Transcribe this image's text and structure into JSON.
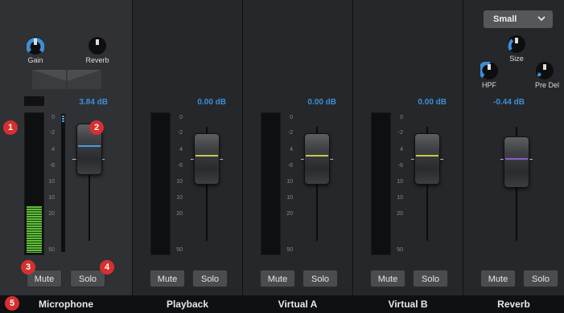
{
  "channels": [
    {
      "name": "Microphone",
      "db": "3.84 dB",
      "mute": "Mute",
      "solo": "Solo"
    },
    {
      "name": "Playback",
      "db": "0.00 dB",
      "mute": "Mute",
      "solo": "Solo"
    },
    {
      "name": "Virtual A",
      "db": "0.00 dB",
      "mute": "Mute",
      "solo": "Solo"
    },
    {
      "name": "Virtual B",
      "db": "0.00 dB",
      "mute": "Mute",
      "solo": "Solo"
    },
    {
      "name": "Reverb",
      "db": "-0.44 dB",
      "mute": "Mute",
      "solo": "Solo"
    }
  ],
  "mic_knobs": {
    "gain": "Gain",
    "reverb": "Reverb"
  },
  "reverb_knobs": {
    "size": "Size",
    "hpf": "HPF",
    "pre_delay": "Pre Del"
  },
  "reverb_size_select": {
    "value": "Small",
    "chevron_icon": "chevron-down-icon"
  },
  "scale_ticks": [
    "0",
    "-2",
    "4",
    "-6",
    "10",
    "10",
    "20",
    "30",
    "50"
  ],
  "mic_meter_level": 0.33,
  "callouts": [
    "1",
    "2",
    "3",
    "4",
    "5"
  ],
  "colors": {
    "accent": "#3b8fd9",
    "meter_green": "#5fbf3a",
    "callout": "#d72f2f",
    "reverb_fader": "#8a5fc2",
    "channel_fader": "#c9c94a",
    "mic_fader": "#4a9ad9"
  }
}
